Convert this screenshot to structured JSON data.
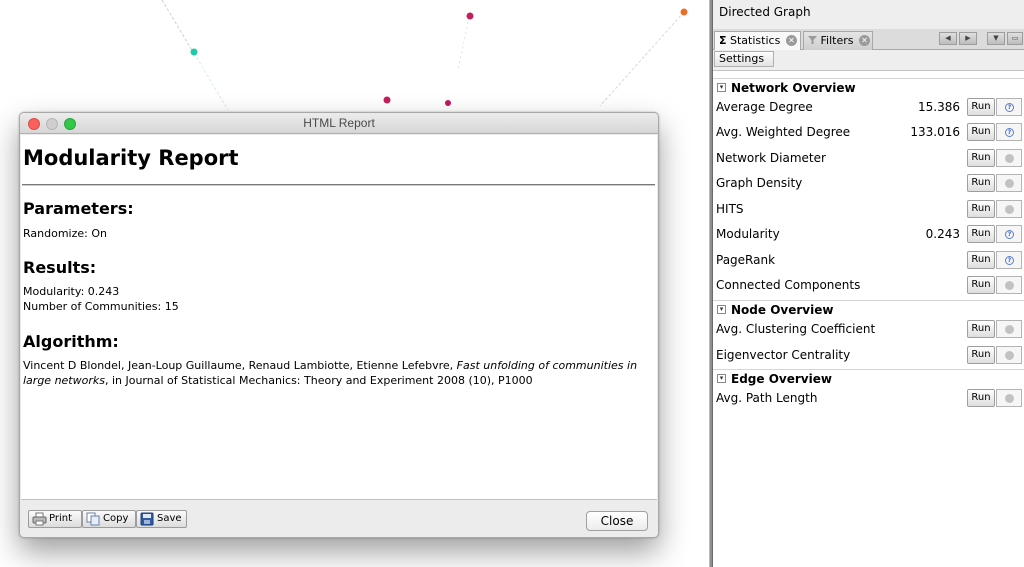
{
  "report": {
    "window_title": "HTML Report",
    "heading": "Modularity Report",
    "parameters_heading": "Parameters:",
    "parameters_text": "Randomize: On",
    "results_heading": "Results:",
    "results_modularity": "Modularity: 0.243",
    "results_communities": "Number of Communities: 15",
    "algorithm_heading": "Algorithm:",
    "algorithm_authors": "Vincent D Blondel, Jean-Loup Guillaume, Renaud Lambiotte, Etienne Lefebvre, ",
    "algorithm_title": "Fast unfolding of communities in large networks",
    "algorithm_rest": ", in Journal of Statistical Mechanics: Theory and Experiment 2008 (10), P1000",
    "buttons": {
      "print": "Print",
      "copy": "Copy",
      "save": "Save",
      "close": "Close"
    }
  },
  "panel": {
    "title": "Directed Graph",
    "tabs": {
      "statistics": "Statistics",
      "filters": "Filters"
    },
    "settings_label": "Settings",
    "sections": {
      "network": "Network Overview",
      "node": "Node Overview",
      "edge": "Edge Overview"
    },
    "run_label": "Run",
    "rows": {
      "avg_degree": {
        "label": "Average Degree",
        "value": "15.386",
        "icon": "help-icon"
      },
      "avg_weighted_degree": {
        "label": "Avg. Weighted Degree",
        "value": "133.016",
        "icon": "help-icon"
      },
      "network_diameter": {
        "label": "Network Diameter",
        "value": "",
        "icon": "status-dot-icon"
      },
      "graph_density": {
        "label": "Graph Density",
        "value": "",
        "icon": "status-dot-icon"
      },
      "hits": {
        "label": "HITS",
        "value": "",
        "icon": "status-dot-icon"
      },
      "modularity": {
        "label": "Modularity",
        "value": "0.243",
        "icon": "help-icon"
      },
      "pagerank": {
        "label": "PageRank",
        "value": "",
        "icon": "help-icon"
      },
      "connected_components": {
        "label": "Connected Components",
        "value": "",
        "icon": "status-dot-icon"
      },
      "avg_clustering": {
        "label": "Avg. Clustering Coefficient",
        "value": "",
        "icon": "status-dot-icon"
      },
      "eigenvector": {
        "label": "Eigenvector Centrality",
        "value": "",
        "icon": "status-dot-icon"
      },
      "avg_path_length": {
        "label": "Avg. Path Length",
        "value": "",
        "icon": "status-dot-icon"
      }
    }
  },
  "graph": {
    "node_colors": [
      "#1fc9a8",
      "#c21f5c",
      "#c21f5c",
      "#c2185b",
      "#e8702a"
    ],
    "edge_color": "#c9c9c9"
  }
}
